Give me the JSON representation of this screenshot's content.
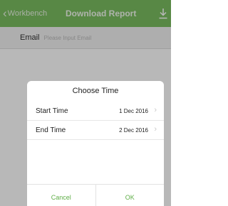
{
  "navbar": {
    "back_label": "Workbench",
    "title": "Download Report",
    "back_icon": "chevron-left-icon",
    "action_icon": "download-icon"
  },
  "email": {
    "label": "Email",
    "placeholder": "Please Input Email",
    "value": ""
  },
  "dialog": {
    "title": "Choose Time",
    "start_label": "Start Time",
    "start_value": "1 Dec 2016",
    "end_label": "End Time",
    "end_value": "2 Dec 2016",
    "chevron": "›",
    "cancel_label": "Cancel",
    "ok_label": "OK"
  },
  "colors": {
    "navbar": "#7bbd60",
    "accent": "#5fae47"
  }
}
